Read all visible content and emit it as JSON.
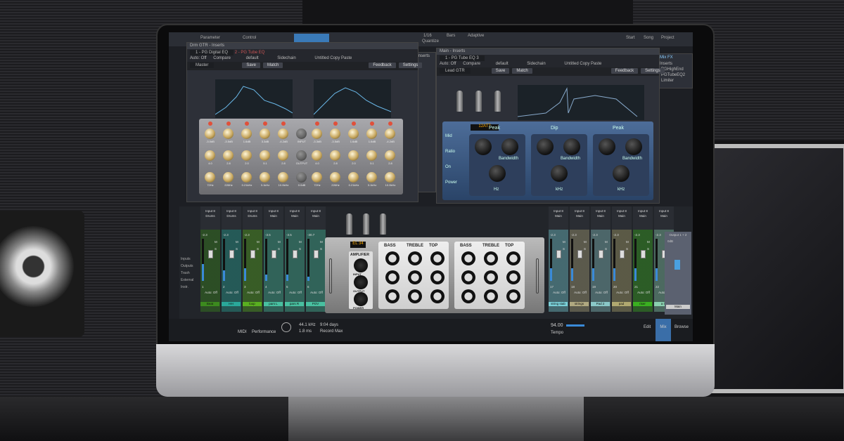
{
  "daw": {
    "top_tabs": [
      "Parameter",
      "Control"
    ],
    "top_right": [
      "Start",
      "Song",
      "Project"
    ],
    "top_center": [
      "1/16",
      "Quantize",
      "Bars",
      "Adaptive"
    ],
    "mix_fx": [
      "Mix FX",
      "Inserts",
      "PGHighEnd",
      "PGTubeEQ2",
      "Limiter"
    ],
    "insert_label": "Inserts"
  },
  "plugin_left": {
    "window_title": "Drm GTR - Inserts",
    "tabs": [
      "1 - PG Digital EQ",
      "2 - PG Tube EQ"
    ],
    "auto": "Auto: Off",
    "compare": "Compare",
    "copy": "Copy",
    "paste": "Paste",
    "preset": "default",
    "sidechain": "Sidechain",
    "untitled": "Untitled",
    "channel": "Master",
    "save": "Save",
    "match": "Match",
    "feedback": "Feedback",
    "settings": "Settings",
    "gains": [
      "-3.0dB",
      "-3.5dB",
      "1.6dB",
      "3.3dB",
      "-4.2dB",
      "-3.3dB",
      "-3.5dB",
      "1.6dB",
      "1.6dB",
      "-4.2dB"
    ],
    "qs": [
      "4.0",
      "2.8",
      "2.0",
      "5.1",
      "2.8",
      "4.0",
      "2.8",
      "2.0",
      "5.1",
      "2.8"
    ],
    "freqs": [
      "72Hz",
      "226Hz",
      "0.21kHz",
      "3.1kHz",
      "10.0kHz",
      "72Hz",
      "226Hz",
      "0.21kHz",
      "3.1kHz",
      "10.0kHz"
    ],
    "center_labels": [
      "INPUT",
      "OUTPUT",
      "0.0dB"
    ]
  },
  "plugin_right": {
    "window_title": "Main - Inserts",
    "tabs": [
      "1 - PG Tube EQ 3"
    ],
    "auto": "Auto: Off",
    "compare": "Compare",
    "copy": "Copy",
    "paste": "Paste",
    "preset": "default",
    "sidechain": "Sidechain",
    "untitled": "Untitled",
    "channel": "Lead GTR",
    "save": "Save",
    "match": "Match",
    "feedback": "Feedback",
    "settings": "Settings",
    "tube_type": "12AT7",
    "sections": [
      {
        "title": "Peak",
        "sub": "Bandwidth",
        "unit": "Hz"
      },
      {
        "title": "Dip",
        "sub": "Bandwidth",
        "unit": "kHz"
      },
      {
        "title": "Peak",
        "sub": "Bandwidth",
        "unit": "kHz"
      }
    ],
    "side_labels": [
      "Mid",
      "Ratio",
      "On",
      "Power"
    ]
  },
  "plugin_center": {
    "tube_type": "EL 34",
    "amp_label": "AMPLIFIER",
    "amp_knobs": [
      "INPUT",
      "OUTPUT",
      "POWER"
    ],
    "bands": [
      "BASS",
      "TREBLE",
      "TOP",
      "BASS",
      "TREBLE",
      "TOP"
    ]
  },
  "mixer": {
    "side_menu": [
      "Inputs",
      "Outputs",
      "Trash",
      "External",
      "Instr."
    ],
    "left_channels": [
      {
        "input": "Input 8",
        "bus": "Drums",
        "vol": "-2.3",
        "num": "1",
        "name": "Beat",
        "color": "#3c8a1e",
        "level": 0.4
      },
      {
        "input": "Input 8",
        "bus": "Drums",
        "vol": "-2.3",
        "num": "2",
        "name": "HH",
        "color": "#2aa89a",
        "level": 0.25
      },
      {
        "input": "Input 8",
        "bus": "Drums",
        "vol": "-2.3",
        "num": "3",
        "name": "loop",
        "color": "#5ab020",
        "level": 0.3
      },
      {
        "input": "Input 8",
        "bus": "Main",
        "vol": "-3.5",
        "num": "4",
        "name": "pars L",
        "color": "#48c0a0",
        "level": 0.15
      },
      {
        "input": "Input 8",
        "bus": "Main",
        "vol": "-3.5",
        "num": "5",
        "name": "pars R",
        "color": "#48c0a0",
        "level": 0.15
      },
      {
        "input": "Input 8",
        "bus": "Main",
        "vol": "-30.7",
        "num": "6",
        "name": "POV",
        "color": "#48c0a0",
        "level": 0.1
      }
    ],
    "right_channels": [
      {
        "input": "Input 8",
        "bus": "Main",
        "vol": "-2.3",
        "num": "17",
        "name": "string stab",
        "color": "#7ad0d8",
        "level": 0.3
      },
      {
        "input": "Input 8",
        "bus": "Main",
        "vol": "-2.3",
        "num": "18",
        "name": "strings",
        "color": "#b0a880",
        "level": 0.3
      },
      {
        "input": "Input 8",
        "bus": "Main",
        "vol": "-2.3",
        "num": "19",
        "name": "Pad 2",
        "color": "#8ac8c8",
        "level": 0.3
      },
      {
        "input": "Input 8",
        "bus": "Main",
        "vol": "-2.3",
        "num": "20",
        "name": "pad",
        "color": "#b0a870",
        "level": 0.3
      },
      {
        "input": "Input 8",
        "bus": "Main",
        "vol": "-2.3",
        "num": "21",
        "name": "riser",
        "color": "#3ab020",
        "level": 0.3
      },
      {
        "input": "Input 8",
        "bus": "Main",
        "vol": "-2.3",
        "num": "22",
        "name": "a lo",
        "color": "#8ad0b0",
        "level": 0.3
      }
    ],
    "output": {
      "label": "Output 1 + 2",
      "name": "Main",
      "vol": "0dB"
    },
    "auto_off": "Auto: Off",
    "strip_buttons": [
      "M",
      "S"
    ]
  },
  "status": {
    "midi": "MIDI",
    "performance": "Performance",
    "rate": "44.1 kHz",
    "latency": "1.8 ms",
    "record_time": "9:04 days",
    "record_label": "Record Max",
    "tempo": "94.00",
    "tempo_label": "Tempo"
  },
  "view_buttons": [
    "Edit",
    "Mix",
    "Browse"
  ],
  "colors": {
    "accent": "#3a8ad8",
    "mix_active": "#3a6ea8"
  }
}
